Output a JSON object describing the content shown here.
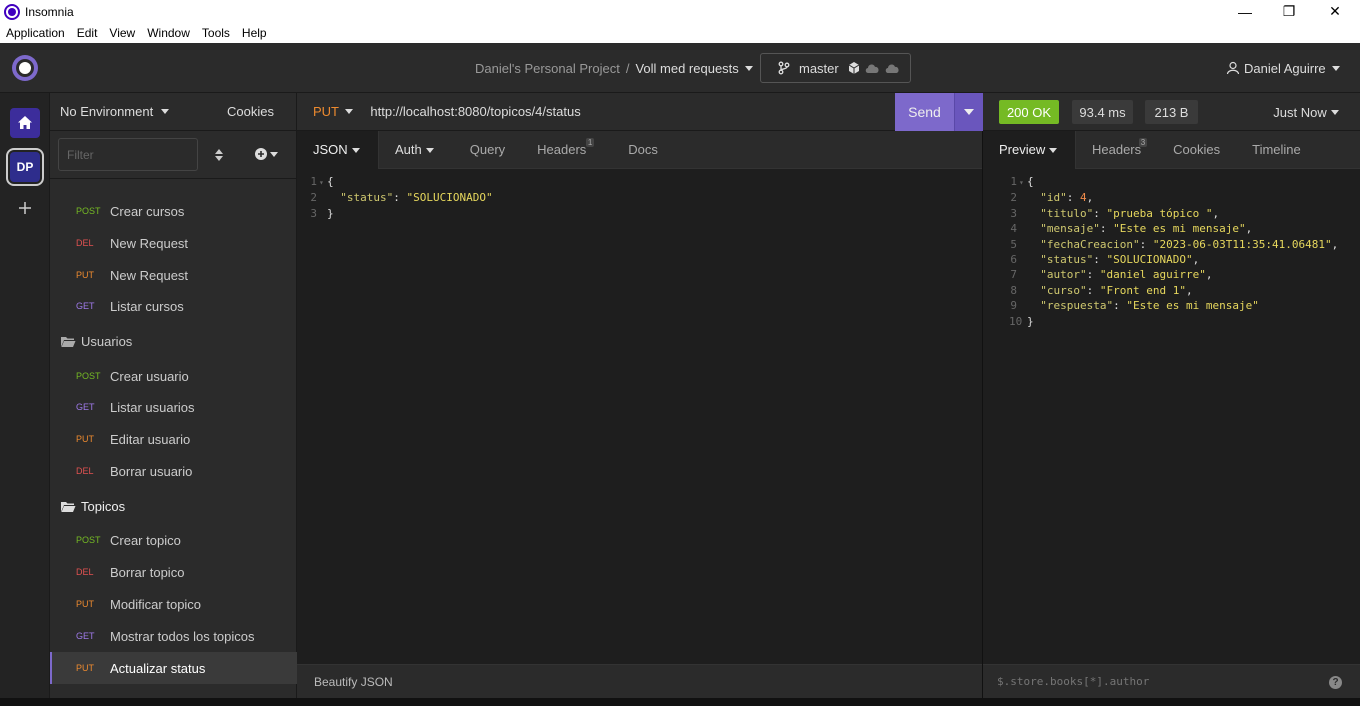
{
  "window": {
    "title": "Insomnia",
    "controls": {
      "minimize": "—",
      "maximize": "❐",
      "close": "✕"
    }
  },
  "menubar": [
    "Application",
    "Edit",
    "View",
    "Window",
    "Tools",
    "Help"
  ],
  "header": {
    "breadcrumb_project": "Daniel's Personal Project",
    "breadcrumb_sep": "/",
    "breadcrumb_collection": "Voll med requests",
    "branch": "master",
    "user": "Daniel Aguirre"
  },
  "rail": {
    "workspace_initials": "DP"
  },
  "sidebar": {
    "environment": "No Environment",
    "cookies": "Cookies",
    "filter_placeholder": "Filter",
    "items": [
      {
        "method": "POST",
        "name": "Crear cursos"
      },
      {
        "method": "DEL",
        "name": "New Request"
      },
      {
        "method": "PUT",
        "name": "New Request"
      },
      {
        "method": "GET",
        "name": "Listar cursos"
      }
    ],
    "folders": [
      {
        "name": "Usuarios",
        "items": [
          {
            "method": "POST",
            "name": "Crear usuario"
          },
          {
            "method": "GET",
            "name": "Listar usuarios"
          },
          {
            "method": "PUT",
            "name": "Editar usuario"
          },
          {
            "method": "DEL",
            "name": "Borrar usuario"
          }
        ]
      },
      {
        "name": "Topicos",
        "items": [
          {
            "method": "POST",
            "name": "Crear topico"
          },
          {
            "method": "DEL",
            "name": "Borrar topico"
          },
          {
            "method": "PUT",
            "name": "Modificar topico"
          },
          {
            "method": "GET",
            "name": "Mostrar todos los topicos"
          },
          {
            "method": "PUT",
            "name": "Actualizar status"
          }
        ]
      }
    ]
  },
  "request": {
    "method": "PUT",
    "url": "http://localhost:8080/topicos/4/status",
    "send_label": "Send",
    "tabs": {
      "body": "JSON",
      "auth": "Auth",
      "query": "Query",
      "headers": "Headers",
      "headers_count": "1",
      "docs": "Docs"
    },
    "body_lines": [
      {
        "n": "1",
        "text": "{"
      },
      {
        "n": "2",
        "key": "\"status\"",
        "value": "\"SOLUCIONADO\""
      },
      {
        "n": "3",
        "text": "}"
      }
    ],
    "footer_label": "Beautify JSON"
  },
  "response": {
    "status": "200 OK",
    "time": "93.4 ms",
    "size": "213 B",
    "when": "Just Now",
    "tabs": {
      "preview": "Preview",
      "headers": "Headers",
      "headers_count": "3",
      "cookies": "Cookies",
      "timeline": "Timeline"
    },
    "lines": [
      {
        "n": "1",
        "text": "{"
      },
      {
        "n": "2",
        "key": "\"id\"",
        "num": "4",
        "comma": ","
      },
      {
        "n": "3",
        "key": "\"titulo\"",
        "value": "\"prueba tópico \"",
        "comma": ","
      },
      {
        "n": "4",
        "key": "\"mensaje\"",
        "value": "\"Este es mi mensaje\"",
        "comma": ","
      },
      {
        "n": "5",
        "key": "\"fechaCreacion\"",
        "value": "\"2023-06-03T11:35:41.06481\"",
        "comma": ","
      },
      {
        "n": "6",
        "key": "\"status\"",
        "value": "\"SOLUCIONADO\"",
        "comma": ","
      },
      {
        "n": "7",
        "key": "\"autor\"",
        "value": "\"daniel aguirre\"",
        "comma": ","
      },
      {
        "n": "8",
        "key": "\"curso\"",
        "value": "\"Front end 1\"",
        "comma": ","
      },
      {
        "n": "9",
        "key": "\"respuesta\"",
        "value": "\"Este es mi mensaje\"",
        "comma": ""
      },
      {
        "n": "10",
        "text": "}"
      }
    ],
    "filter_placeholder": "$.store.books[*].author",
    "help": "?"
  },
  "colors": {
    "accent": "#7d69cb",
    "post": "#75ba24",
    "del": "#e15251",
    "put": "#ed8a2f",
    "get": "#9f7aea",
    "ok": "#75ba24"
  }
}
